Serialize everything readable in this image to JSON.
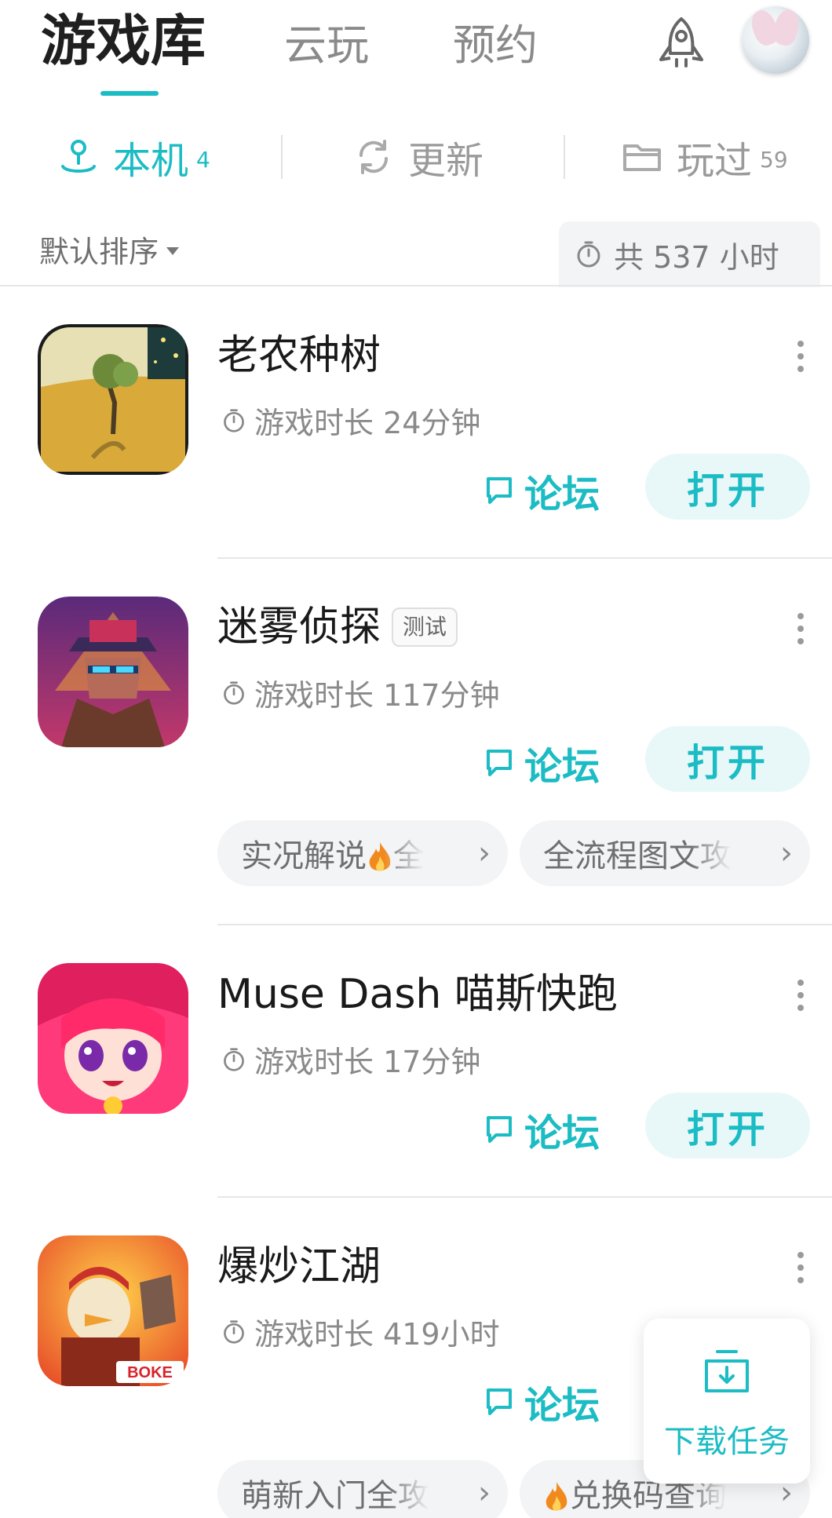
{
  "nav": {
    "tabs": [
      {
        "label": "游戏库",
        "active": true
      },
      {
        "label": "云玩",
        "active": false
      },
      {
        "label": "预约",
        "active": false
      }
    ],
    "rocket_icon": "rocket-icon",
    "avatar_icon": "user-avatar"
  },
  "subtabs": [
    {
      "label": "本机",
      "count": "4",
      "icon": "location-person-icon",
      "active": true
    },
    {
      "label": "更新",
      "count": "",
      "icon": "refresh-icon",
      "active": false
    },
    {
      "label": "玩过",
      "count": "59",
      "icon": "folder-icon",
      "active": false
    }
  ],
  "sort": {
    "label": "默认排序"
  },
  "total_time": {
    "label": "共 537 小时"
  },
  "games": [
    {
      "title": "老农种树",
      "badge": "",
      "playtime": "游戏时长 24分钟",
      "forum": "论坛",
      "open": "打开",
      "chips": []
    },
    {
      "title": "迷雾侦探",
      "badge": "测试",
      "playtime": "游戏时长 117分钟",
      "forum": "论坛",
      "open": "打开",
      "chips": [
        {
          "text": "实况解说",
          "flame": true,
          "tail": "全"
        },
        {
          "text": "全流程图文攻",
          "flame": false,
          "tail": ""
        }
      ]
    },
    {
      "title": "Muse Dash 喵斯快跑",
      "badge": "",
      "playtime": "游戏时长 17分钟",
      "forum": "论坛",
      "open": "打开",
      "chips": []
    },
    {
      "title": "爆炒江湖",
      "badge": "",
      "playtime": "游戏时长 419小时",
      "forum": "论坛",
      "open": "",
      "chips": [
        {
          "text": "萌新入门全攻",
          "flame": false,
          "tail": ""
        },
        {
          "text": "兑换码查询",
          "flame": true,
          "tail": ""
        }
      ]
    }
  ],
  "download": {
    "label": "下载任务",
    "icon": "download-tray-icon"
  },
  "colors": {
    "accent": "#1cbcc4",
    "open_bg": "#e8f8f9",
    "chip_bg": "#f3f4f6"
  }
}
